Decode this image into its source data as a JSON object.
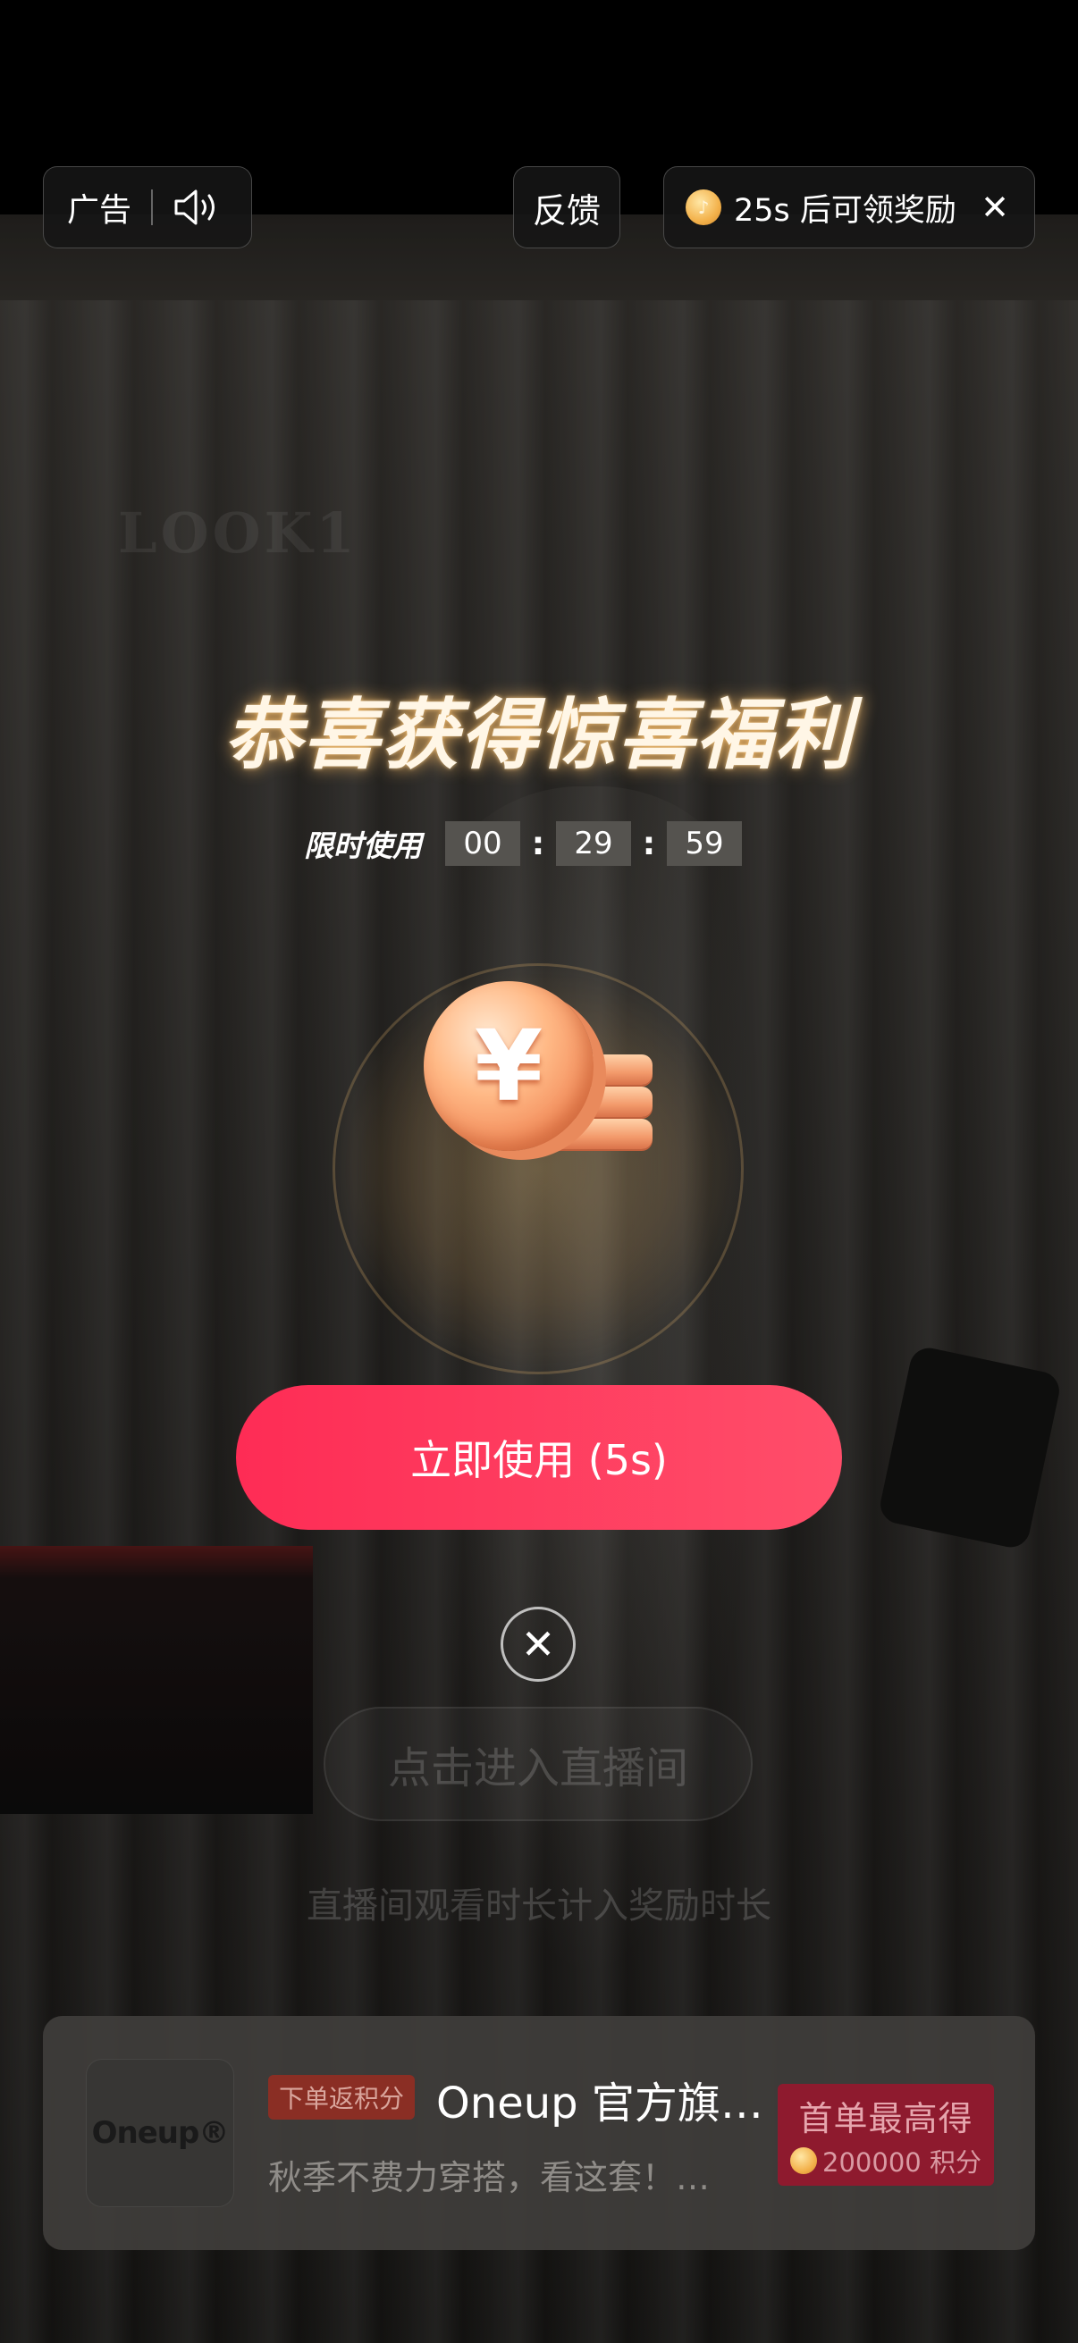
{
  "top_bar": {
    "ad_label": "广告",
    "feedback_label": "反馈",
    "reward_countdown": "25s 后可领奖励",
    "close_glyph": "✕"
  },
  "background": {
    "watermark": "LOOK1"
  },
  "modal": {
    "title": "恭喜获得惊喜福利",
    "timer_label": "限时使用",
    "timer": {
      "hours": "00",
      "minutes": "29",
      "seconds": "59"
    },
    "timer_separator": ":",
    "coin_symbol": "¥",
    "cta_label": "立即使用 (5s)",
    "close_glyph": "✕"
  },
  "live": {
    "button_label": "点击进入直播间",
    "note": "直播间观看时长计入奖励时长"
  },
  "ad_card": {
    "logo_text": "Oneup®",
    "tag": "下单返积分",
    "name": "Oneup 官方旗…",
    "description": "秋季不费力穿搭，看这套！…",
    "offer_title": "首单最高得",
    "offer_points": "200000 积分"
  },
  "colors": {
    "cta_red": "#fe2c55",
    "offer_bg": "#8e1a2e",
    "tag_bg": "#8a2e24",
    "coin_orange": "#f28b5a"
  }
}
